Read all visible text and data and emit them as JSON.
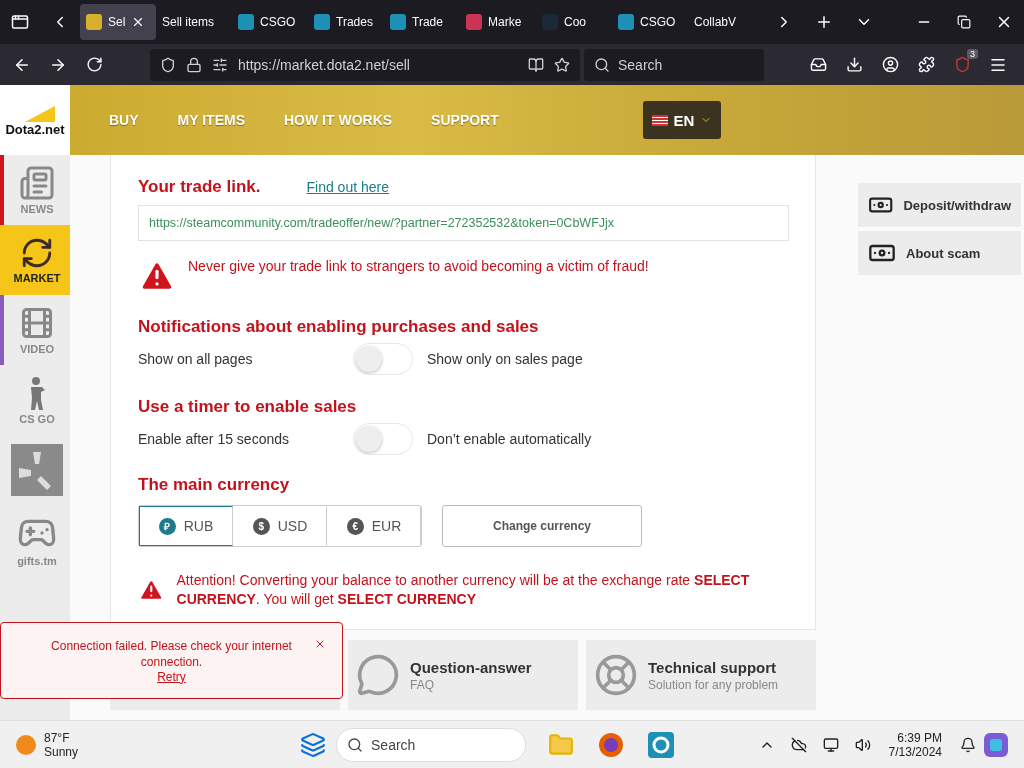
{
  "browser": {
    "tabs": [
      {
        "label": "Sel",
        "kind": "dota",
        "selected": true
      },
      {
        "label": "Sell items",
        "kind": "plain",
        "selected": false
      },
      {
        "label": "CSGO",
        "kind": "market",
        "selected": false
      },
      {
        "label": "Trades",
        "kind": "market",
        "selected": false
      },
      {
        "label": "Trade",
        "kind": "market",
        "selected": false
      },
      {
        "label": "Marke",
        "kind": "picture",
        "selected": false
      },
      {
        "label": "Coo",
        "kind": "steam",
        "selected": false
      },
      {
        "label": "CSGO",
        "kind": "market",
        "selected": false
      },
      {
        "label": "CollabV",
        "kind": "plain",
        "selected": false
      }
    ],
    "url": "https://market.dota2.net/sell",
    "search_placeholder": "Search",
    "extension_badge": "3"
  },
  "site": {
    "logo": "Dota2.net",
    "nav": [
      "BUY",
      "MY ITEMS",
      "HOW IT WORKS",
      "SUPPORT"
    ],
    "language": "EN"
  },
  "sidebar": [
    {
      "kind": "news",
      "label": "NEWS",
      "selected": false,
      "color": "#d0141e"
    },
    {
      "kind": "market",
      "label": "MARKET",
      "selected": true,
      "color": "#f5c518"
    },
    {
      "kind": "video",
      "label": "VIDEO",
      "selected": false,
      "color": "#8a5cc2"
    },
    {
      "kind": "csgo",
      "label": "CS GO",
      "selected": false
    },
    {
      "kind": "rust",
      "selected": false
    },
    {
      "kind": "gifts",
      "label": "gifts.tm",
      "selected": false
    }
  ],
  "trade_link": {
    "title": "Your trade link.",
    "help_link": "Find out here",
    "value": "https://steamcommunity.com/tradeoffer/new/?partner=272352532&token=0CbWFJjx",
    "warning": "Never give your trade link to strangers to avoid becoming a victim of fraud!"
  },
  "settings": [
    {
      "title": "Notifications about enabling purchases and sales",
      "left_label": "Show on all pages",
      "on": false,
      "right_label": "Show only on sales page"
    },
    {
      "title": "Use a timer to enable sales",
      "left_label": "Enable after 15 seconds",
      "on": false,
      "right_label": "Don’t enable automatically"
    }
  ],
  "currency": {
    "title": "The main currency",
    "options": [
      {
        "symbol": "₽",
        "label": "RUB",
        "selected": true
      },
      {
        "symbol": "$",
        "label": "USD",
        "selected": false
      },
      {
        "symbol": "€",
        "label": "EUR",
        "selected": false
      }
    ],
    "button": "Change currency",
    "warning": "Attention! Converting your balance to another currency will be at the exchange rate **SELECT CURRENCY**. You will get **SELECT CURRENCY**"
  },
  "right_menu": [
    {
      "label": "Deposit/withdraw"
    },
    {
      "label": "About scam"
    }
  ],
  "info_cards": [
    {
      "kind": "market"
    },
    {
      "kind": "faq",
      "title": "Question-answer",
      "subtitle": "FAQ"
    },
    {
      "kind": "support",
      "title": "Technical support",
      "subtitle": "Solution for any problem"
    }
  ],
  "toast": {
    "message": "Connection failed. Please check your internet connection.",
    "action": "Retry"
  },
  "taskbar": {
    "temperature": "87°F",
    "weather": "Sunny",
    "search_placeholder": "Search",
    "time": "6:39 PM",
    "date": "7/13/2024"
  }
}
